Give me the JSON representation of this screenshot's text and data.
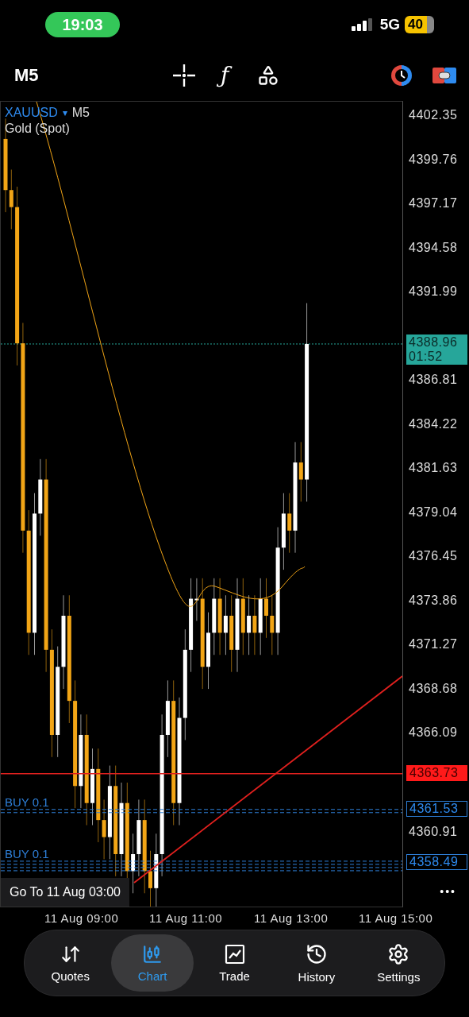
{
  "status_bar": {
    "time": "19:03",
    "network": "5G",
    "battery": "40"
  },
  "toolbar": {
    "timeframe": "M5",
    "indicator_glyph": "ƒ"
  },
  "chart": {
    "symbol": "XAUUSD",
    "symbol_caret": "▾",
    "timeframe": "M5",
    "description": "Gold (Spot)",
    "price_labels": [
      "4402.35",
      "4399.76",
      "4397.17",
      "4394.58",
      "4391.99",
      "4386.81",
      "4384.22",
      "4381.63",
      "4379.04",
      "4376.45",
      "4373.86",
      "4371.27",
      "4368.68",
      "4366.09",
      "4360.91"
    ],
    "current_price": {
      "price": "4388.96",
      "countdown": "01:52"
    },
    "alert_line": {
      "price": "4363.73"
    },
    "orders": [
      {
        "label": "BUY 0.1",
        "price": "4361.53"
      },
      {
        "label": "BUY 0.1",
        "price": "4358.49"
      }
    ],
    "goto_button": "Go To 11 Aug 03:00",
    "more": "•••",
    "time_labels": [
      "11 Aug 09:00",
      "11 Aug 11:00",
      "11 Aug 13:00",
      "11 Aug 15:00"
    ]
  },
  "nav": [
    {
      "kind": "quotes",
      "label": "Quotes",
      "selected": false
    },
    {
      "kind": "chart",
      "label": "Chart",
      "selected": true
    },
    {
      "kind": "trade",
      "label": "Trade",
      "selected": false
    },
    {
      "kind": "history",
      "label": "History",
      "selected": false
    },
    {
      "kind": "settings",
      "label": "Settings",
      "selected": false
    }
  ]
}
